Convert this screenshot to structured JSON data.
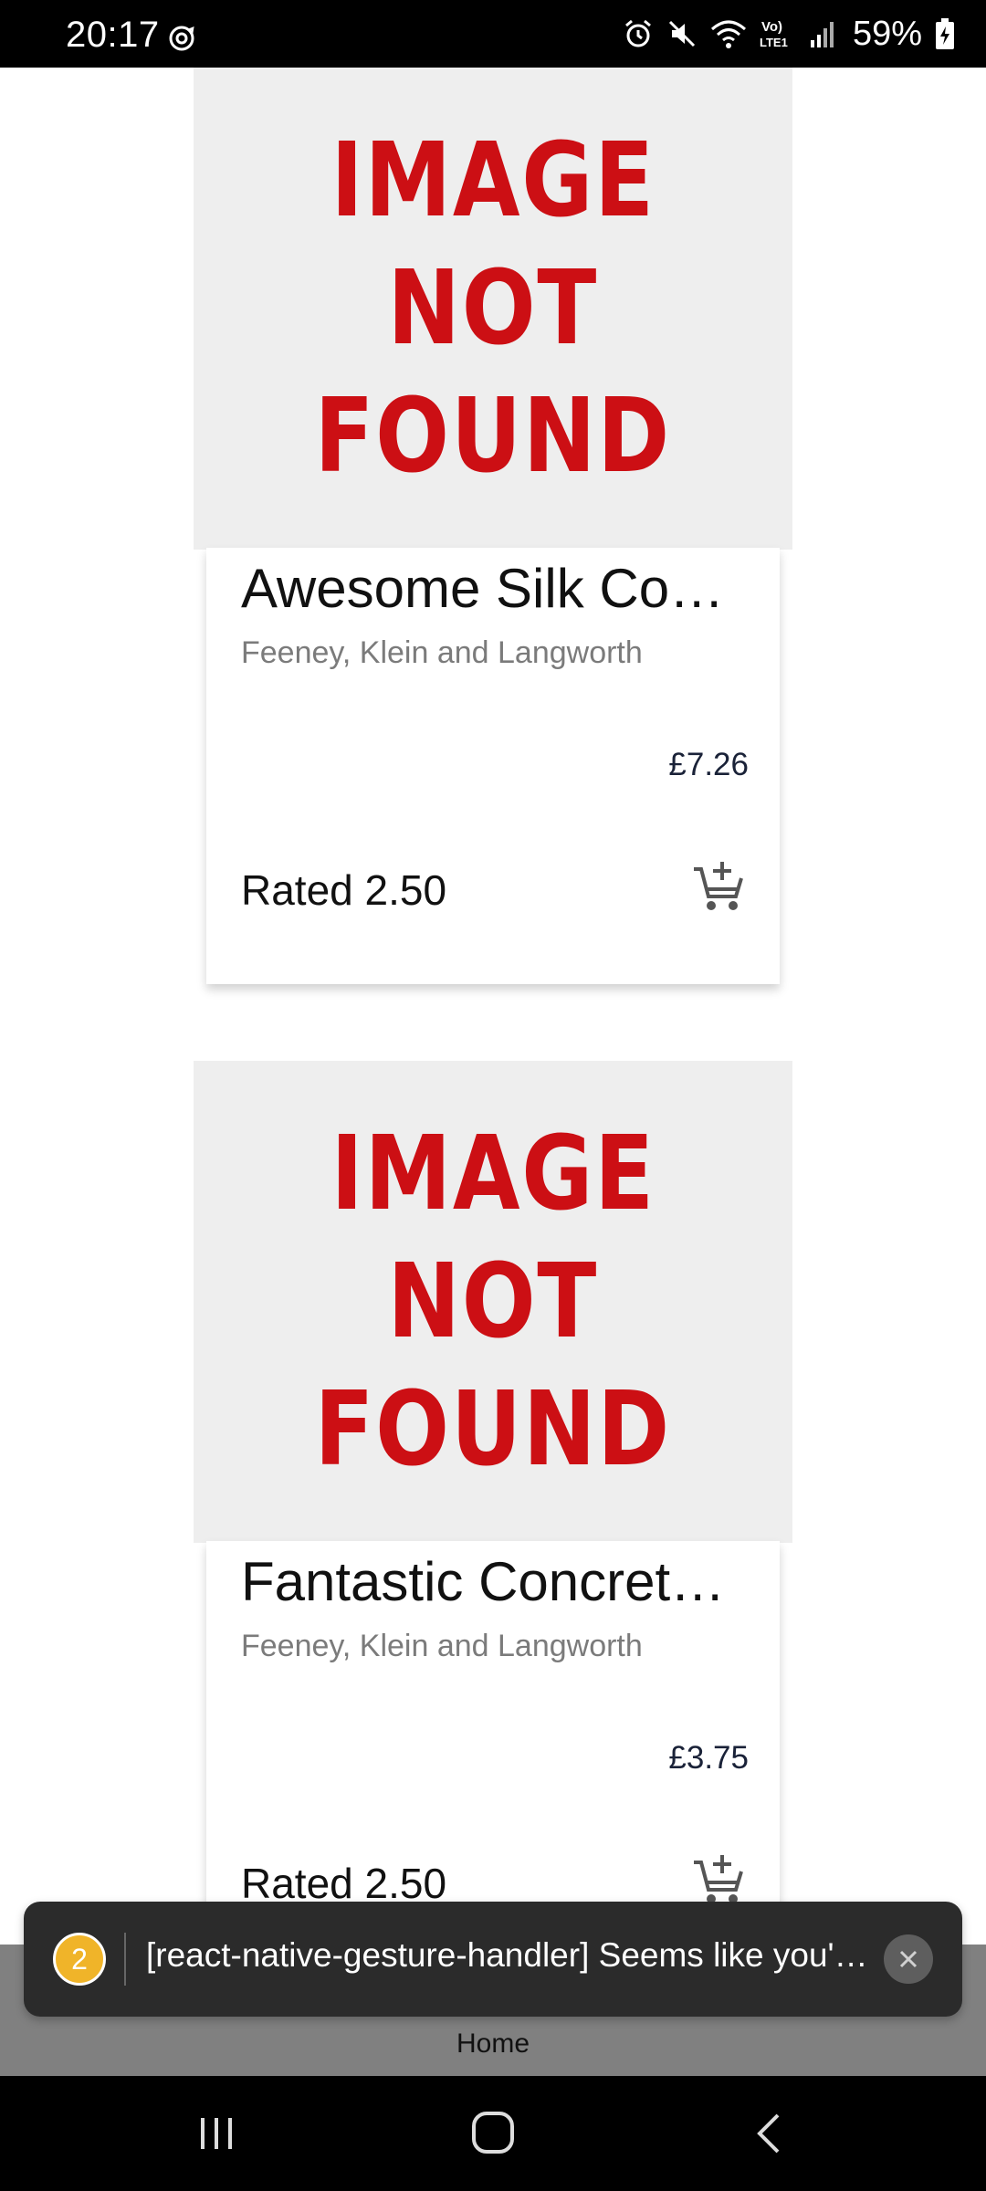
{
  "status_bar": {
    "time": "20:17",
    "battery": "59%",
    "icons": [
      "sync-icon",
      "alarm-icon",
      "mute-icon",
      "wifi-icon",
      "volte-icon",
      "signal-icon",
      "battery-charging-icon"
    ]
  },
  "products": [
    {
      "image_text": [
        "IMAGE",
        "NOT",
        "FOUND"
      ],
      "title": "Awesome Silk Co…",
      "vendor": "Feeney, Klein and Langworth",
      "price": "£7.26",
      "rating": "Rated 2.50",
      "cart_icon": "add-to-cart-icon"
    },
    {
      "image_text": [
        "IMAGE",
        "NOT",
        "FOUND"
      ],
      "title": "Fantastic Concret…",
      "vendor": "Feeney, Klein and Langworth",
      "price": "£3.75",
      "rating": "Rated 2.50",
      "cart_icon": "add-to-cart-icon"
    }
  ],
  "toast": {
    "count": "2",
    "message": "[react-native-gesture-handler] Seems like you'r…"
  },
  "tab_bar": {
    "home_label": "Home"
  },
  "colors": {
    "image_text": "#cc0f14",
    "image_bg": "#eeeeee",
    "toast_bg": "#2b2b2b",
    "badge": "#f0b429",
    "tab_bar": "#808080"
  }
}
